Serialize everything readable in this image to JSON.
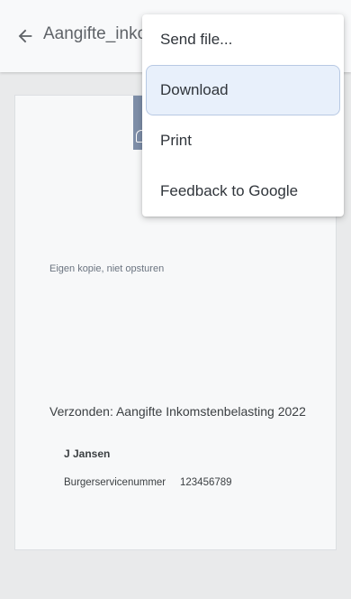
{
  "header": {
    "title": "Aangifte_inko"
  },
  "menu": {
    "items": [
      {
        "label": "Send file..."
      },
      {
        "label": "Download"
      },
      {
        "label": "Print"
      },
      {
        "label": "Feedback to Google"
      }
    ]
  },
  "document": {
    "copy_note": "Eigen kopie, niet opsturen",
    "sent_title": "Verzonden: Aangifte Inkomstenbelasting 2022",
    "name": "J Jansen",
    "bsn_label": "Burgerservicenummer",
    "bsn_value": "123456789"
  },
  "icons": {
    "back": "arrow-left-icon",
    "logo": "logo-icon"
  },
  "colors": {
    "menu_highlight_bg": "#e8f0fb",
    "logo_block": "#7e8ea8",
    "topbar_bg": "#f8f9fa",
    "viewer_bg": "#e9eaeb"
  }
}
